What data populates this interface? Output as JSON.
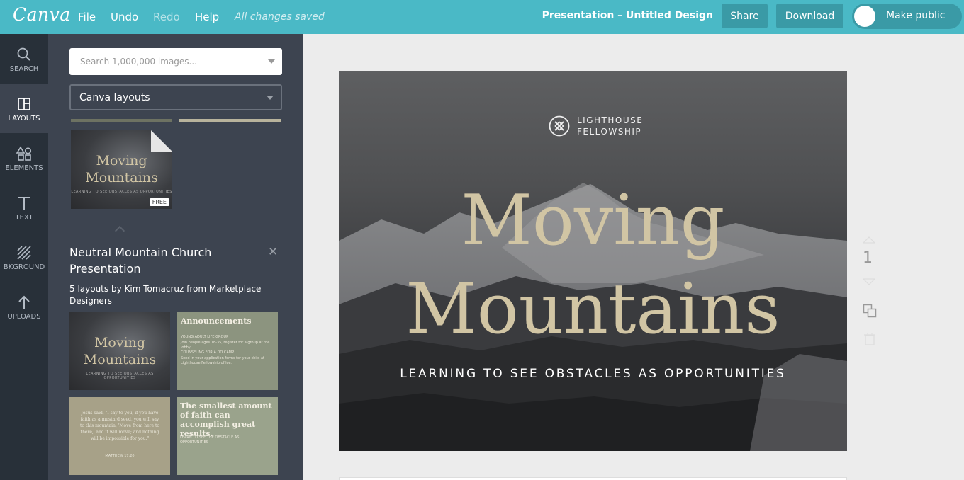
{
  "topbar": {
    "logo": "Canva",
    "menu": [
      "File",
      "Undo",
      "Redo",
      "Help"
    ],
    "status": "All changes saved",
    "doc_title": "Presentation – Untitled Design",
    "share": "Share",
    "download": "Download",
    "make_public": "Make public",
    "colors": {
      "bar": "#4ab9c6",
      "button": "#3a9aa6"
    }
  },
  "rail": {
    "items": [
      {
        "label": "SEARCH",
        "icon": "search-icon"
      },
      {
        "label": "LAYOUTS",
        "icon": "layouts-icon",
        "active": true
      },
      {
        "label": "ELEMENTS",
        "icon": "elements-icon"
      },
      {
        "label": "TEXT",
        "icon": "text-icon"
      },
      {
        "label": "BKGROUND",
        "icon": "background-icon"
      },
      {
        "label": "UPLOADS",
        "icon": "upload-icon"
      }
    ]
  },
  "panel": {
    "search_placeholder": "Search 1,000,000 images...",
    "dropdown_value": "Canva layouts",
    "featured": {
      "title_line1": "Moving",
      "title_line2": "Mountains",
      "sub": "LEARNING TO SEE OBSTACLES AS OPPORTUNITIES",
      "badge": "FREE"
    },
    "collection_title": "Neutral Mountain Church Presentation",
    "collection_sub": "5 layouts by Kim Tomacruz from Marketplace Designers",
    "layouts": [
      {
        "kind": "cover",
        "title_line1": "Moving",
        "title_line2": "Mountains",
        "sub": "LEARNING TO SEE OBSTACLES AS OPPORTUNITIES"
      },
      {
        "kind": "announcements",
        "title": "Announcements",
        "items": [
          "YOUNG ADULT LIFE GROUP",
          "Join people ages 18-35, register for a group at the lobby.",
          "COUNSELING FOR A DO CAMP",
          "Send in your application forms for your child at Lighthouse Fellowship office."
        ]
      },
      {
        "kind": "quote",
        "text": "Jesus said, \"I say to you, if you have faith as a mustard seed, you will say to this mountain, 'Move from here to there,' and it will move; and nothing will be impossible for you.\"",
        "ref": "MATTHEW 17:20"
      },
      {
        "kind": "statement",
        "text": "The smallest amount of faith can accomplish great results.",
        "sub": "LEARN TO SEE THE OBSTACLE AS OPPORTUNITIES"
      }
    ]
  },
  "slide": {
    "org_line1": "LIGHTHOUSE",
    "org_line2": "FELLOWSHIP",
    "title_line1": "Moving",
    "title_line2": "Mountains",
    "subtitle": "LEARNING TO SEE OBSTACLES AS OPPORTUNITIES",
    "accent": "#d1c5a4",
    "page_number": "1"
  }
}
